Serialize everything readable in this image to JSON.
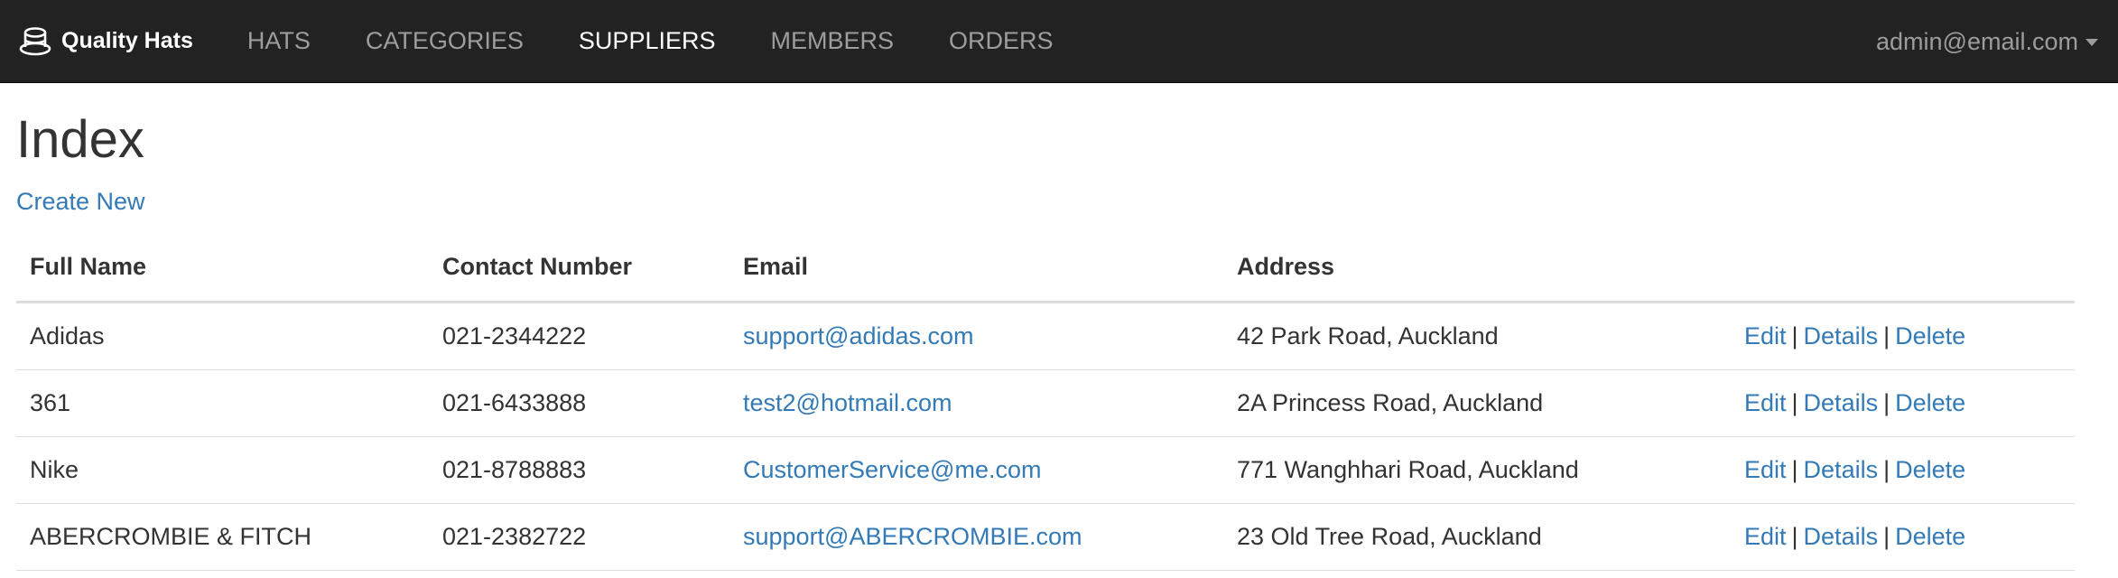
{
  "navbar": {
    "brand": "Quality Hats",
    "brand_icon": "hat-icon",
    "links": [
      {
        "label": "HATS",
        "active": false
      },
      {
        "label": "CATEGORIES",
        "active": false
      },
      {
        "label": "SUPPLIERS",
        "active": true
      },
      {
        "label": "MEMBERS",
        "active": false
      },
      {
        "label": "ORDERS",
        "active": false
      }
    ],
    "user": "admin@email.com"
  },
  "page": {
    "title": "Index",
    "create_new": "Create New"
  },
  "table": {
    "headers": {
      "full_name": "Full Name",
      "contact_number": "Contact Number",
      "email": "Email",
      "address": "Address"
    },
    "rows": [
      {
        "name": "Adidas",
        "phone": "021-2344222",
        "email": "support@adidas.com",
        "address": "42 Park Road, Auckland"
      },
      {
        "name": "361",
        "phone": "021-6433888",
        "email": "test2@hotmail.com",
        "address": "2A Princess Road, Auckland"
      },
      {
        "name": "Nike",
        "phone": "021-8788883",
        "email": "CustomerService@me.com",
        "address": "771 Wanghhari Road, Auckland"
      },
      {
        "name": "ABERCROMBIE & FITCH",
        "phone": "021-2382722",
        "email": "support@ABERCROMBIE.com",
        "address": "23 Old Tree Road, Auckland"
      }
    ],
    "actions": {
      "edit": "Edit",
      "details": "Details",
      "delete": "Delete",
      "separator": "|"
    }
  },
  "colors": {
    "navbar_bg": "#222222",
    "link": "#337ab7",
    "nav_inactive": "#9d9d9d",
    "nav_active": "#ffffff"
  }
}
